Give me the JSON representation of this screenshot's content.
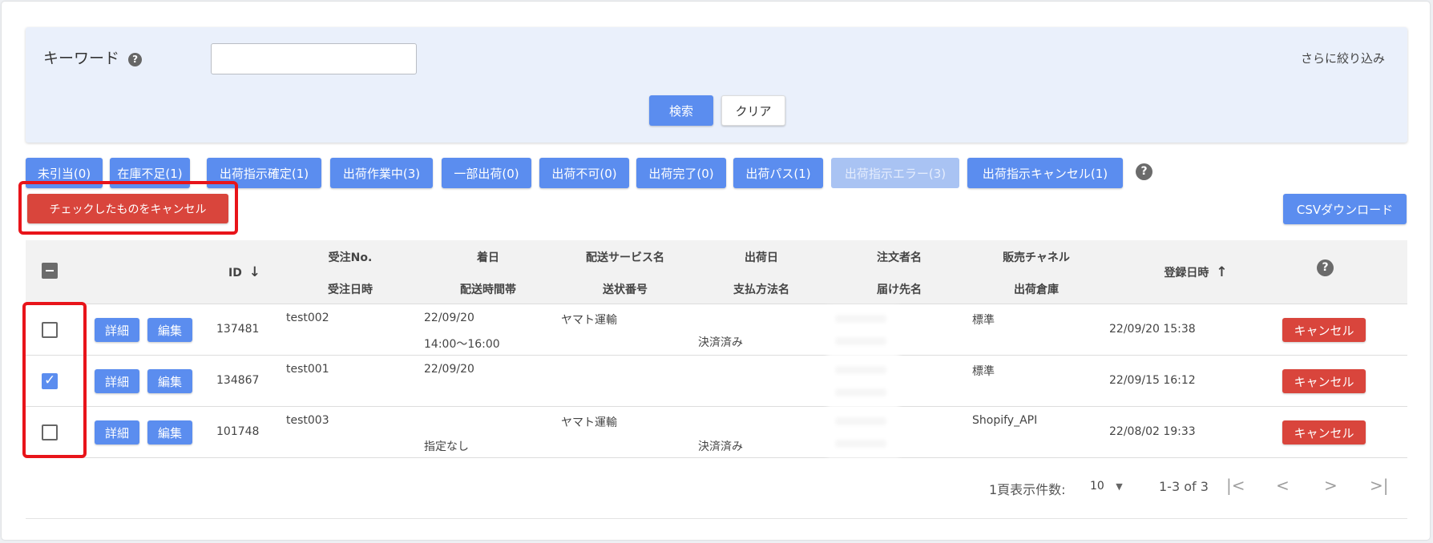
{
  "search": {
    "keyword_label": "キーワード",
    "keyword_value": "",
    "more_filter": "さらに絞り込み",
    "search_button": "検索",
    "clear_button": "クリア"
  },
  "status_tabs": [
    {
      "label": "未引当(0)",
      "disabled": false
    },
    {
      "label": "在庫不足(1)",
      "disabled": false
    },
    {
      "label": "出荷指示確定(1)",
      "disabled": false
    },
    {
      "label": "出荷作業中(3)",
      "disabled": false
    },
    {
      "label": "一部出荷(0)",
      "disabled": false
    },
    {
      "label": "出荷不可(0)",
      "disabled": false
    },
    {
      "label": "出荷完了(0)",
      "disabled": false
    },
    {
      "label": "出荷パス(1)",
      "disabled": false
    },
    {
      "label": "出荷指示エラー(3)",
      "disabled": true
    },
    {
      "label": "出荷指示キャンセル(1)",
      "disabled": false
    }
  ],
  "actions": {
    "cancel_checked": "チェックしたものをキャンセル",
    "csv_download": "CSVダウンロード"
  },
  "table": {
    "headers": {
      "id": "ID",
      "id_sort": "↓",
      "order_no": "受注No.",
      "order_date": "受注日時",
      "arrival_date": "着日",
      "delivery_time": "配送時間帯",
      "delivery_service": "配送サービス名",
      "tracking_no": "送状番号",
      "ship_date": "出荷日",
      "payment": "支払方法名",
      "orderer": "注文者名",
      "recipient": "届け先名",
      "channel": "販売チャネル",
      "warehouse": "出荷倉庫",
      "registered_at": "登録日時",
      "registered_sort": "↑",
      "help": "?"
    },
    "rows": [
      {
        "checked": false,
        "detail": "詳細",
        "edit": "編集",
        "id": "137481",
        "order_no": "test002",
        "arrival_date": "22/09/20",
        "delivery_time": "14:00〜16:00",
        "delivery_service": "ヤマト運輸",
        "payment": "決済済み",
        "channel": "標準",
        "registered_at": "22/09/20 15:38",
        "cancel": "キャンセル"
      },
      {
        "checked": true,
        "detail": "詳細",
        "edit": "編集",
        "id": "134867",
        "order_no": "test001",
        "arrival_date": "22/09/20",
        "delivery_time": "",
        "delivery_service": "",
        "payment": "",
        "channel": "標準",
        "registered_at": "22/09/15 16:12",
        "cancel": "キャンセル"
      },
      {
        "checked": false,
        "detail": "詳細",
        "edit": "編集",
        "id": "101748",
        "order_no": "test003",
        "arrival_date": "",
        "delivery_time": "指定なし",
        "delivery_service": "ヤマト運輸",
        "payment": "決済済み",
        "channel": "Shopify_API",
        "registered_at": "22/08/02 19:33",
        "cancel": "キャンセル"
      }
    ]
  },
  "pagination": {
    "rows_per_page_label": "1頁表示件数:",
    "rows_per_page": "10",
    "range": "1-3 of 3"
  },
  "icons": {
    "help": "?",
    "first_page": "|<",
    "prev_page": "<",
    "next_page": ">",
    "last_page": ">|",
    "dropdown": "▼",
    "check": "✓"
  },
  "colors": {
    "primary": "#5b8def",
    "danger": "#d9453c",
    "highlight": "#e8141a",
    "panel": "#eaf0fb"
  }
}
